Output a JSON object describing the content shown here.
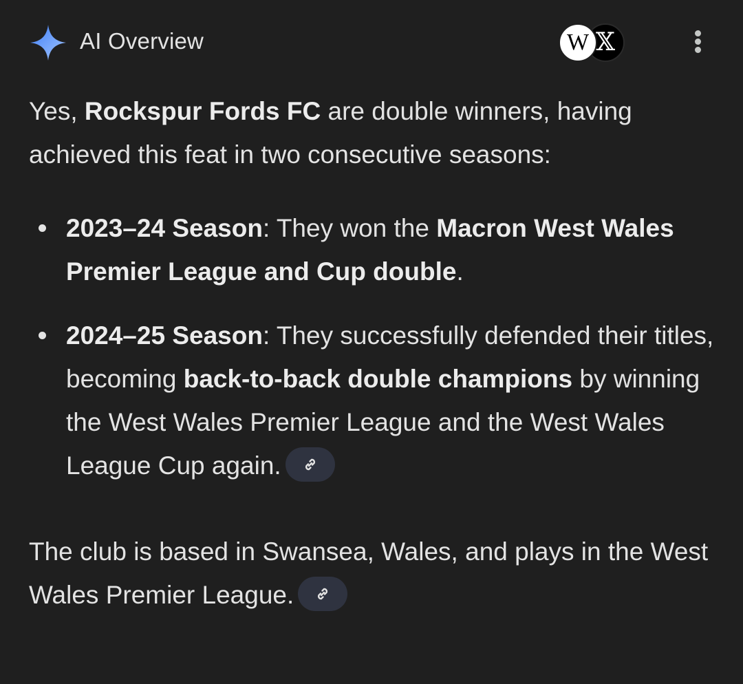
{
  "header": {
    "title": "AI Overview",
    "spark_icon": "gemini-spark-icon",
    "sources": [
      {
        "name": "Wikipedia",
        "glyph": "W"
      },
      {
        "name": "X",
        "glyph": "𝕏"
      }
    ],
    "more_icon": "more-vert-icon"
  },
  "answer": {
    "intro": {
      "lead": "Yes, ",
      "club": "Rockspur Fords FC",
      "rest": " are double winners, having achieved this feat in two consecutive seasons:"
    },
    "items": [
      {
        "season": "2023–24 Season",
        "text1": ": They won the ",
        "bold1": "Macron West Wales Premier League and Cup double",
        "text2": "."
      },
      {
        "season": "2024–25 Season",
        "text1": ": They successfully defended their titles, becoming ",
        "bold1": "back-to-back double champions",
        "text2": " by winning the West Wales Premier League and the West Wales League Cup again."
      }
    ],
    "closing": "The club is based in Swansea, Wales, and plays in the West Wales Premier League."
  },
  "colors": {
    "background": "#1f1f1f",
    "text": "#e3e3e3",
    "chip": "#2f3340",
    "spark_start": "#4f8df6",
    "spark_end": "#9dc1ff"
  }
}
